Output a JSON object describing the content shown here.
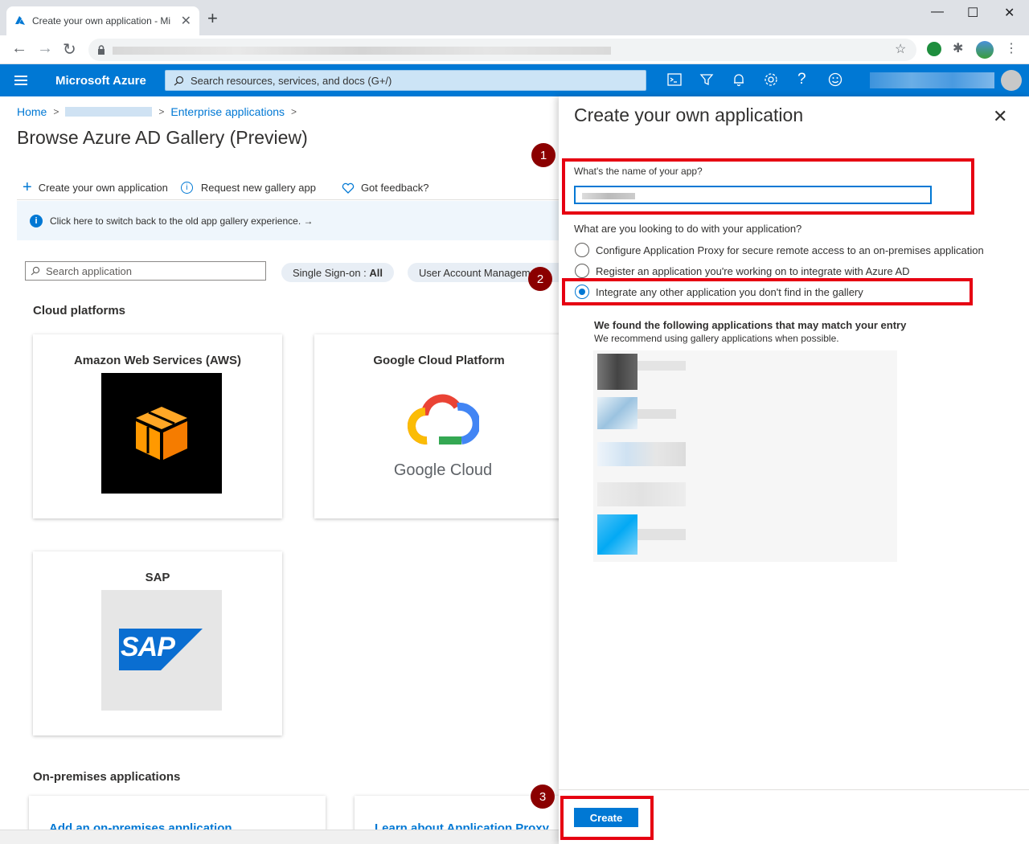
{
  "browser": {
    "tab_title": "Create your own application - Mi",
    "new_tab_glyph": "+",
    "tab_close_glyph": "✕",
    "window_controls": [
      "—",
      "☐",
      "✕"
    ]
  },
  "azure": {
    "brand": "Microsoft Azure",
    "search_placeholder": "Search resources, services, and docs (G+/)"
  },
  "page": {
    "breadcrumb_home": "Home",
    "breadcrumb_sep": ">",
    "breadcrumb_enterprise": "Enterprise applications",
    "title": "Browse Azure AD Gallery (Preview)",
    "toolbar": {
      "create": "Create your own application",
      "request": "Request new gallery app",
      "feedback": "Got feedback?"
    },
    "info_banner": "Click here to switch back to the old app gallery experience. →",
    "search_placeholder": "Search application",
    "filter_sso_label": "Single Sign-on : ",
    "filter_sso_value": "All",
    "filter_uam": "User Account Managem",
    "section_cloud": "Cloud platforms",
    "cards": {
      "aws": "Amazon Web Services (AWS)",
      "gcp": "Google Cloud Platform",
      "sap": "SAP",
      "gcp_logo_text": "Google Cloud",
      "sap_logo_text": "SAP"
    },
    "section_onprem": "On-premises applications",
    "onprem_links": [
      "Add an on-premises application",
      "Learn about Application Proxy"
    ]
  },
  "panel": {
    "title": "Create your own application",
    "name_label": "What's the name of your app?",
    "purpose_label": "What are you looking to do with your application?",
    "options": [
      "Configure Application Proxy for secure remote access to an on-premises application",
      "Register an application you're working on to integrate with Azure AD",
      "Integrate any other application you don't find in the gallery"
    ],
    "selected_option": 2,
    "match_heading": "We found the following applications that may match your entry",
    "match_sub": "We recommend using gallery applications when possible.",
    "create_button": "Create"
  },
  "markers": [
    "1",
    "2",
    "3"
  ],
  "colors": {
    "azure_blue": "#0078d4",
    "annotation_red": "#e60012",
    "marker_bg": "#8b0000"
  }
}
